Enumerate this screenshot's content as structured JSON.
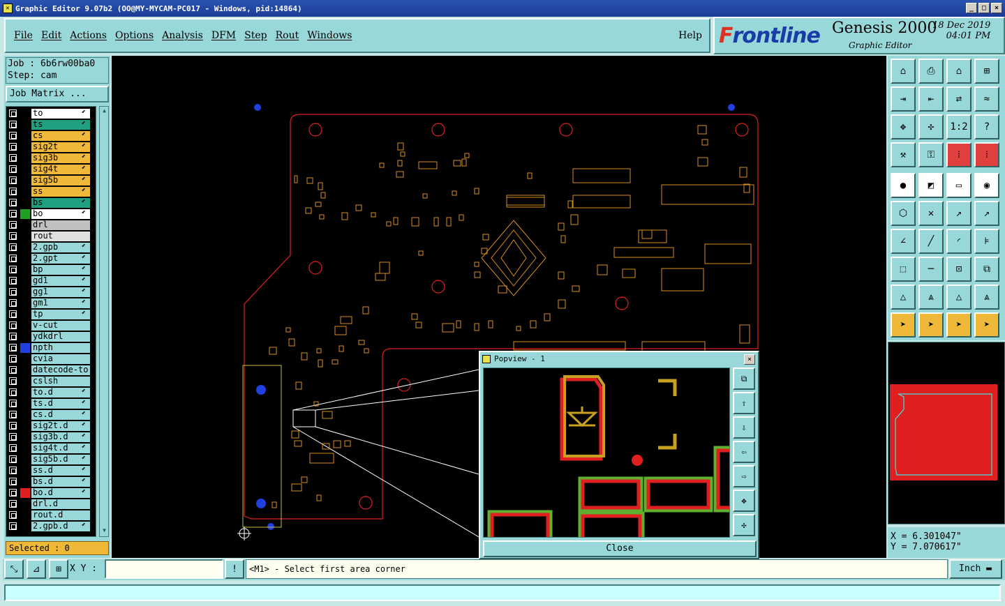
{
  "window": {
    "title": "Graphic Editor 9.07b2  (OO@MY-MYCAM-PC017 - Windows, pid:14864)",
    "controls": [
      "_",
      "□",
      "×"
    ]
  },
  "menu": {
    "items": [
      "File",
      "Edit",
      "Actions",
      "Options",
      "Analysis",
      "DFM",
      "Step",
      "Rout",
      "Windows"
    ],
    "help": "Help"
  },
  "brand": {
    "logo_prefix": "F",
    "logo_rest": "rontline",
    "product": "Genesis 2000",
    "subtitle": "Graphic Editor",
    "date": "18 Dec 2019",
    "time": "04:01 PM"
  },
  "job": {
    "job_line": "Job : 6b6rw00ba0",
    "step_line": "Step: cam",
    "matrix_button": "Job Matrix ..."
  },
  "layers": [
    {
      "name": "to",
      "color": "#ffffff",
      "swatch": "#000000",
      "arrow": true
    },
    {
      "name": "ts",
      "color": "#20a080",
      "swatch": "#000000",
      "arrow": true
    },
    {
      "name": "cs",
      "color": "#f0b838",
      "swatch": "#000000",
      "arrow": true
    },
    {
      "name": "sig2t",
      "color": "#f0b838",
      "swatch": "#000000",
      "arrow": true
    },
    {
      "name": "sig3b",
      "color": "#f0b838",
      "swatch": "#000000",
      "arrow": true
    },
    {
      "name": "sig4t",
      "color": "#f0b838",
      "swatch": "#000000",
      "arrow": true
    },
    {
      "name": "sig5b",
      "color": "#f0b838",
      "swatch": "#000000",
      "arrow": true
    },
    {
      "name": "ss",
      "color": "#f0b838",
      "swatch": "#000000",
      "arrow": true
    },
    {
      "name": "bs",
      "color": "#20a080",
      "swatch": "#000000",
      "arrow": true
    },
    {
      "name": "bo",
      "color": "#ffffff",
      "swatch": "#20a020",
      "arrow": true
    },
    {
      "name": "drl",
      "color": "#c0c0c0",
      "swatch": "#000000",
      "arrow": false
    },
    {
      "name": "rout",
      "color": "#e0e0e0",
      "swatch": "#000000",
      "arrow": false
    },
    {
      "name": "2.gpb",
      "color": "#98d8d8",
      "swatch": "#000000",
      "arrow": true
    },
    {
      "name": "2.gpt",
      "color": "#98d8d8",
      "swatch": "#000000",
      "arrow": true
    },
    {
      "name": "bp",
      "color": "#98d8d8",
      "swatch": "#000000",
      "arrow": true
    },
    {
      "name": "gd1",
      "color": "#98d8d8",
      "swatch": "#000000",
      "arrow": true
    },
    {
      "name": "gg1",
      "color": "#98d8d8",
      "swatch": "#000000",
      "arrow": true
    },
    {
      "name": "gm1",
      "color": "#98d8d8",
      "swatch": "#000000",
      "arrow": true
    },
    {
      "name": "tp",
      "color": "#98d8d8",
      "swatch": "#000000",
      "arrow": true
    },
    {
      "name": "v-cut",
      "color": "#98d8d8",
      "swatch": "#000000",
      "arrow": false
    },
    {
      "name": "ydkdrl",
      "color": "#98d8d8",
      "swatch": "#000000",
      "arrow": false
    },
    {
      "name": "npth",
      "color": "#98d8d8",
      "swatch": "#2040e0",
      "arrow": false
    },
    {
      "name": "cvia",
      "color": "#98d8d8",
      "swatch": "#000000",
      "arrow": false
    },
    {
      "name": "datecode-to",
      "color": "#98d8d8",
      "swatch": "#000000",
      "arrow": false
    },
    {
      "name": "cslsh",
      "color": "#98d8d8",
      "swatch": "#000000",
      "arrow": false
    },
    {
      "name": "to.d",
      "color": "#98d8d8",
      "swatch": "#000000",
      "arrow": true
    },
    {
      "name": "ts.d",
      "color": "#98d8d8",
      "swatch": "#000000",
      "arrow": true
    },
    {
      "name": "cs.d",
      "color": "#98d8d8",
      "swatch": "#000000",
      "arrow": true
    },
    {
      "name": "sig2t.d",
      "color": "#98d8d8",
      "swatch": "#000000",
      "arrow": true
    },
    {
      "name": "sig3b.d",
      "color": "#98d8d8",
      "swatch": "#000000",
      "arrow": true
    },
    {
      "name": "sig4t.d",
      "color": "#98d8d8",
      "swatch": "#000000",
      "arrow": true
    },
    {
      "name": "sig5b.d",
      "color": "#98d8d8",
      "swatch": "#000000",
      "arrow": true
    },
    {
      "name": "ss.d",
      "color": "#98d8d8",
      "swatch": "#000000",
      "arrow": true
    },
    {
      "name": "bs.d",
      "color": "#98d8d8",
      "swatch": "#000000",
      "arrow": true
    },
    {
      "name": "bo.d",
      "color": "#98d8d8",
      "swatch": "#e02020",
      "arrow": true
    },
    {
      "name": "drl.d",
      "color": "#98d8d8",
      "swatch": "#000000",
      "arrow": false
    },
    {
      "name": "rout.d",
      "color": "#98d8d8",
      "swatch": "#000000",
      "arrow": false
    },
    {
      "name": "2.gpb.d",
      "color": "#98d8d8",
      "swatch": "#000000",
      "arrow": true
    }
  ],
  "selected": "Selected : 0",
  "xy": {
    "label": "X Y :",
    "value": ""
  },
  "prompt": "<M1> - Select first area corner",
  "units": "Inch",
  "coords": {
    "x": "X = 6.301047\"",
    "y": "Y = 7.070617\""
  },
  "popview": {
    "title": "Popview - 1",
    "close": "Close"
  },
  "colors": {
    "panel": "#98d8d8",
    "board_outline": "#e02020",
    "component": "#d89020",
    "via": "#2040e0"
  }
}
